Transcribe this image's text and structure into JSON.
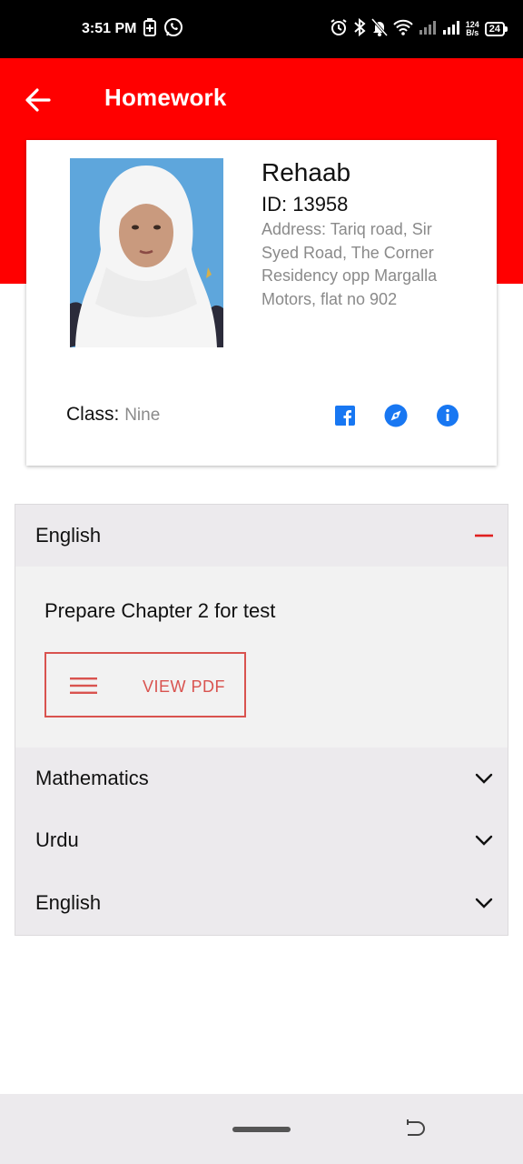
{
  "status_bar": {
    "time": "3:51 PM",
    "netspeed_value": "124",
    "netspeed_unit": "B/s",
    "battery": "24",
    "icons": [
      "battery-saver-icon",
      "whatsapp-icon",
      "alarm-icon",
      "bluetooth-icon",
      "mute-icon",
      "wifi-icon",
      "signal-icon",
      "signal-icon"
    ]
  },
  "app_bar": {
    "title": "Homework",
    "back_icon": "arrow-left-icon",
    "color": "#ff0000"
  },
  "profile": {
    "name": "Rehaab",
    "id": "ID: 13958",
    "address": "Address: Tariq road, Sir Syed Road, The Corner Residency opp Margalla Motors, flat no 902",
    "class_label": "Class:",
    "class_value": "Nine",
    "icons": [
      "facebook-icon",
      "compass-icon",
      "info-icon"
    ],
    "icon_color": "#1877f2"
  },
  "accordion": {
    "expanded": {
      "subject": "English",
      "toggle_icon": "minus-icon",
      "homework": "Prepare Chapter 2 for test",
      "pdf_button": "VIEW PDF",
      "accent": "#d9534f"
    },
    "collapsed": [
      {
        "subject": "Mathematics",
        "toggle_icon": "chevron-down-icon"
      },
      {
        "subject": "Urdu",
        "toggle_icon": "chevron-down-icon"
      },
      {
        "subject": "English",
        "toggle_icon": "chevron-down-icon"
      }
    ]
  },
  "nav_bar": {
    "icons": [
      "home-pill",
      "back-icon"
    ]
  }
}
